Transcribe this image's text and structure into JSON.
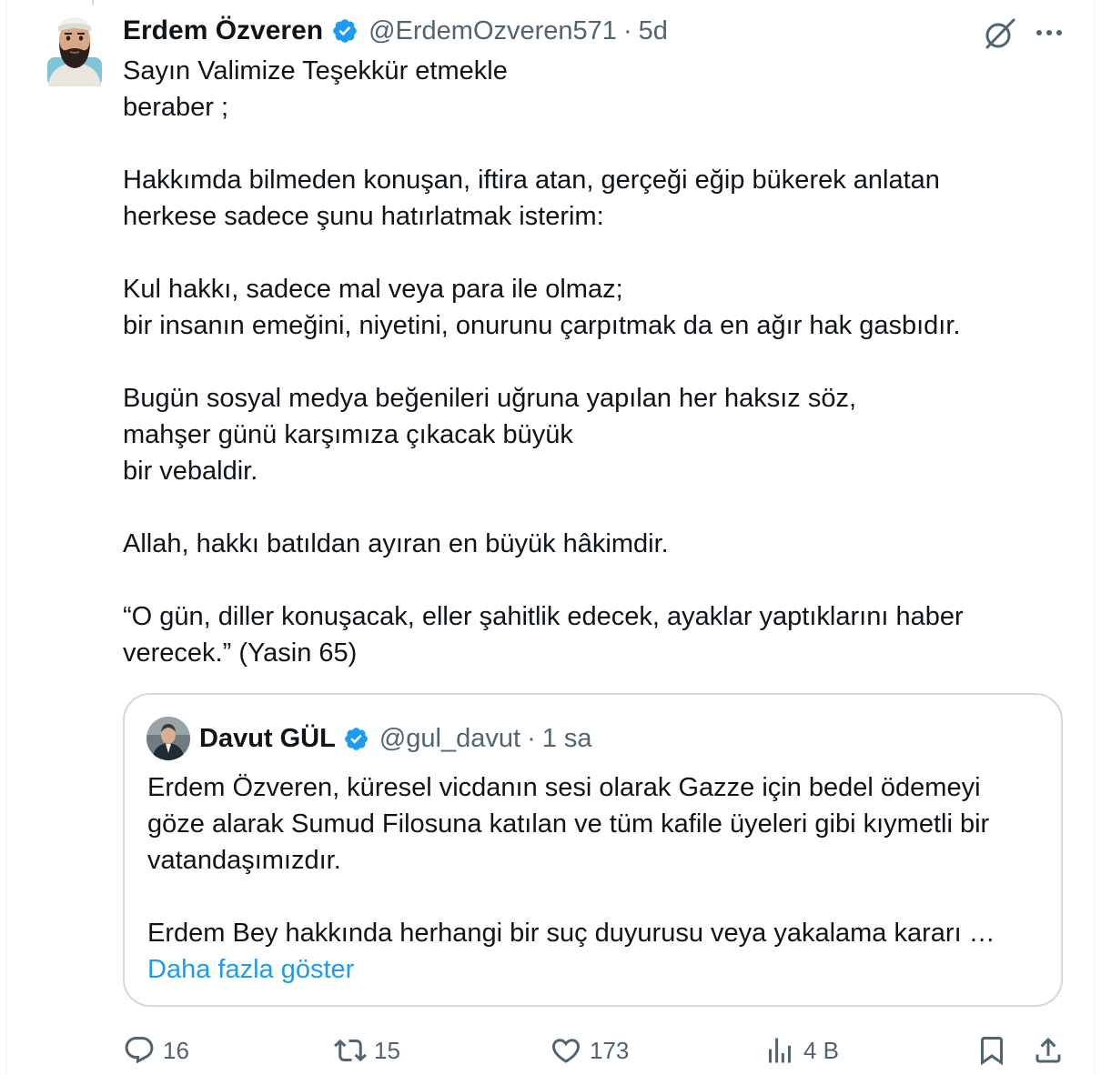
{
  "tweet": {
    "author_name": "Erdem Özveren",
    "handle": "@ErdemOzveren571",
    "separator": "·",
    "time": "5d",
    "text_lines": [
      "Sayın Valimize Teşekkür etmekle",
      "beraber ;",
      "",
      "Hakkımda bilmeden konuşan, iftira atan, gerçeği eğip bükerek anlatan",
      "herkese sadece şunu hatırlatmak isterim:",
      "",
      "Kul hakkı, sadece mal veya para ile olmaz;",
      "bir insanın emeğini, niyetini, onurunu çarpıtmak da en ağır hak gasbıdır.",
      "",
      "Bugün sosyal medya beğenileri uğruna yapılan her haksız söz,",
      "mahşer günü karşımıza çıkacak büyük",
      "bir vebaldir.",
      "",
      "Allah, hakkı batıldan ayıran en büyük hâkimdir.",
      "",
      "“O gün, diller konuşacak, eller şahitlik edecek, ayaklar yaptıklarını haber",
      "verecek.” (Yasin 65)"
    ]
  },
  "quoted": {
    "author_name": "Davut GÜL",
    "handle": "@gul_davut",
    "separator": "·",
    "time": "1 sa",
    "text_lines": [
      "Erdem Özveren, küresel vicdanın sesi olarak Gazze için bedel ödemeyi",
      "göze alarak Sumud Filosuna katılan ve tüm kafile üyeleri gibi kıymetli bir",
      "vatandaşımızdır.",
      "",
      "Erdem Bey hakkında herhangi bir suç duyurusu veya yakalama kararı …"
    ],
    "show_more": "Daha fazla göster"
  },
  "actions": {
    "replies": "16",
    "reposts": "15",
    "likes": "173",
    "views": "4 B"
  },
  "icons": {
    "verified": "verified-badge-icon",
    "grok": "grok-icon",
    "more": "more-icon",
    "reply": "reply-icon",
    "repost": "repost-icon",
    "like": "heart-icon",
    "views": "views-icon",
    "bookmark": "bookmark-icon",
    "share": "share-icon"
  },
  "colors": {
    "text": "#0f1419",
    "secondary": "#536471",
    "accent": "#1d9bf0",
    "border": "#cfd9de"
  }
}
